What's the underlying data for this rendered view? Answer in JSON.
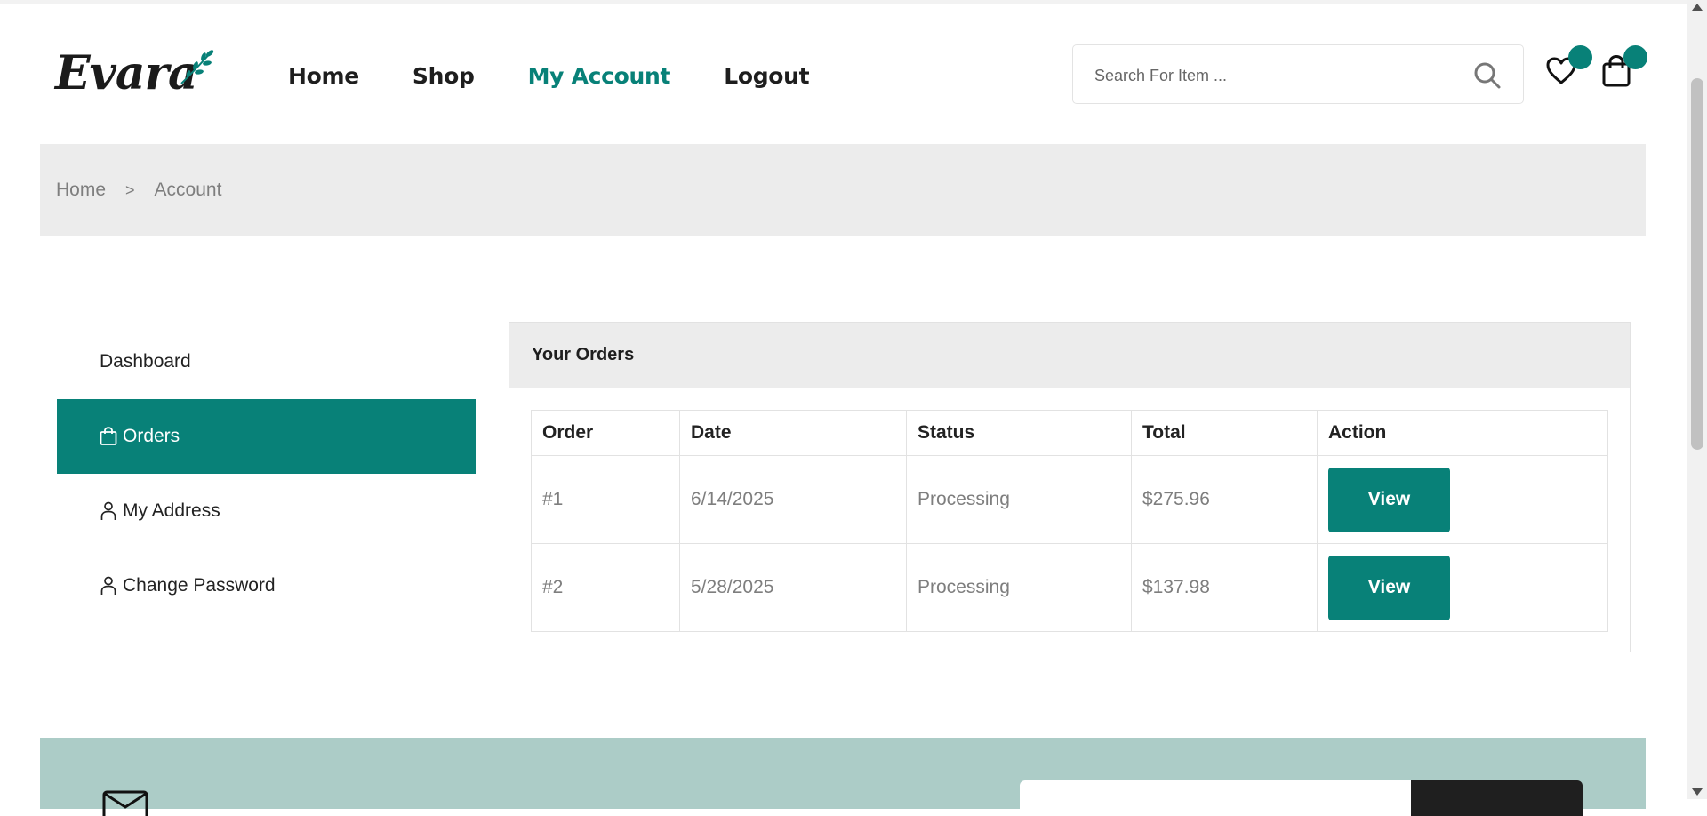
{
  "header": {
    "logo_text": "Evara",
    "nav": [
      {
        "label": "Home",
        "active": false
      },
      {
        "label": "Shop",
        "active": false
      },
      {
        "label": "My Account",
        "active": true
      },
      {
        "label": "Logout",
        "active": false
      }
    ],
    "search_placeholder": "Search For Item ...",
    "icons": [
      "search-icon",
      "heart-icon",
      "shopping-bag-icon"
    ]
  },
  "breadcrumb": {
    "home": "Home",
    "separator": ">",
    "current": "Account"
  },
  "sidebar": {
    "items": [
      {
        "label": "Dashboard",
        "icon": "",
        "active": false
      },
      {
        "label": "Orders",
        "icon": "bag-icon",
        "active": true
      },
      {
        "label": "My Address",
        "icon": "user-icon",
        "active": false
      },
      {
        "label": "Change Password",
        "icon": "user-icon",
        "active": false
      }
    ]
  },
  "orders": {
    "title": "Your Orders",
    "columns": [
      "Order",
      "Date",
      "Status",
      "Total",
      "Action"
    ],
    "rows": [
      {
        "order": "#1",
        "date": "6/14/2025",
        "status": "Processing",
        "total": "$275.96",
        "action": "View"
      },
      {
        "order": "#2",
        "date": "5/28/2025",
        "status": "Processing",
        "total": "$137.98",
        "action": "View"
      }
    ]
  },
  "colors": {
    "brand": "#088178",
    "breadcrumb_bg": "#ececec",
    "newsletter_bg": "#acccc7"
  }
}
